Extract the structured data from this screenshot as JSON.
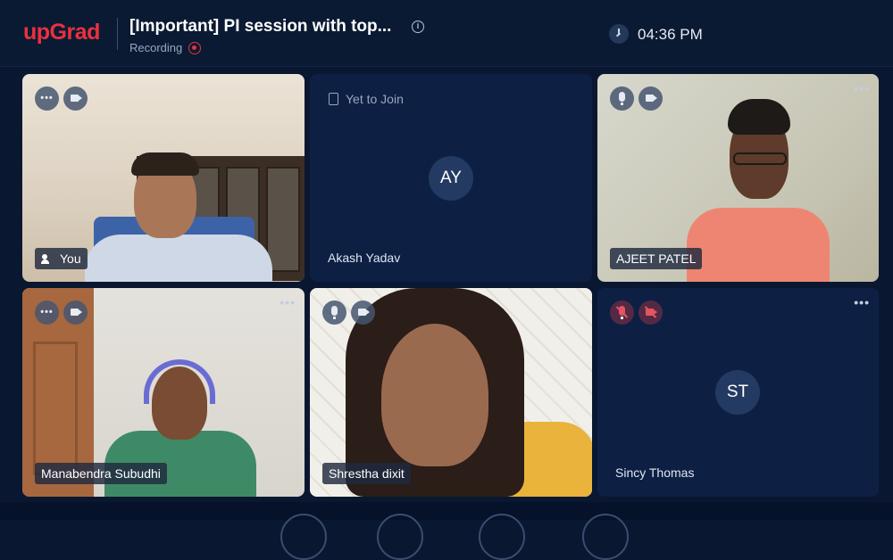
{
  "header": {
    "logo": "upGrad",
    "title": "[Important] PI session with top...",
    "recording_label": "Recording",
    "time": "04:36 PM"
  },
  "tiles": [
    {
      "name": "You",
      "video": true
    },
    {
      "status": "Yet to Join",
      "initials": "AY",
      "name": "Akash Yadav",
      "video": false
    },
    {
      "name": "AJEET PATEL",
      "video": true
    },
    {
      "name": "Manabendra Subudhi",
      "video": true
    },
    {
      "name": "Shrestha dixit",
      "video": true
    },
    {
      "initials": "ST",
      "name": "Sincy Thomas",
      "video": false,
      "mic_muted": true,
      "cam_muted": true
    }
  ],
  "icons": {
    "more": "more-horizontal-icon",
    "camera": "camera-icon",
    "mic": "microphone-icon",
    "speaker": "speaker-icon",
    "info": "info-icon",
    "clock": "clock-icon",
    "recording": "record-icon",
    "join": "door-icon"
  },
  "colors": {
    "brand": "#e9313e",
    "background": "#0a1730",
    "tile": "#0d2044",
    "muted": "#e25561"
  }
}
